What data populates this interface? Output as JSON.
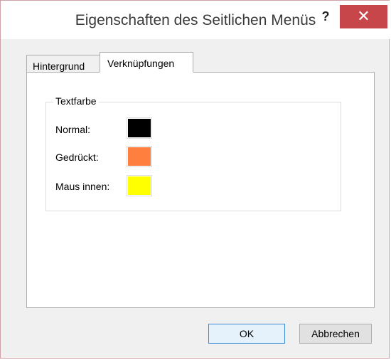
{
  "window": {
    "title": "Eigenschaften des Seitlichen Menüs",
    "help_label": "?",
    "close_label": "✕"
  },
  "tabs": [
    {
      "label": "Hintergrund",
      "selected": false
    },
    {
      "label": "Verknüpfungen",
      "selected": true
    }
  ],
  "textfarbe": {
    "legend": "Textfarbe",
    "rows": [
      {
        "label": "Normal:",
        "color": "#000000"
      },
      {
        "label": "Gedrückt:",
        "color": "#ff7f3f"
      },
      {
        "label": "Maus innen:",
        "color": "#ffff00"
      }
    ]
  },
  "buttons": {
    "ok": "OK",
    "cancel": "Abbrechen"
  }
}
